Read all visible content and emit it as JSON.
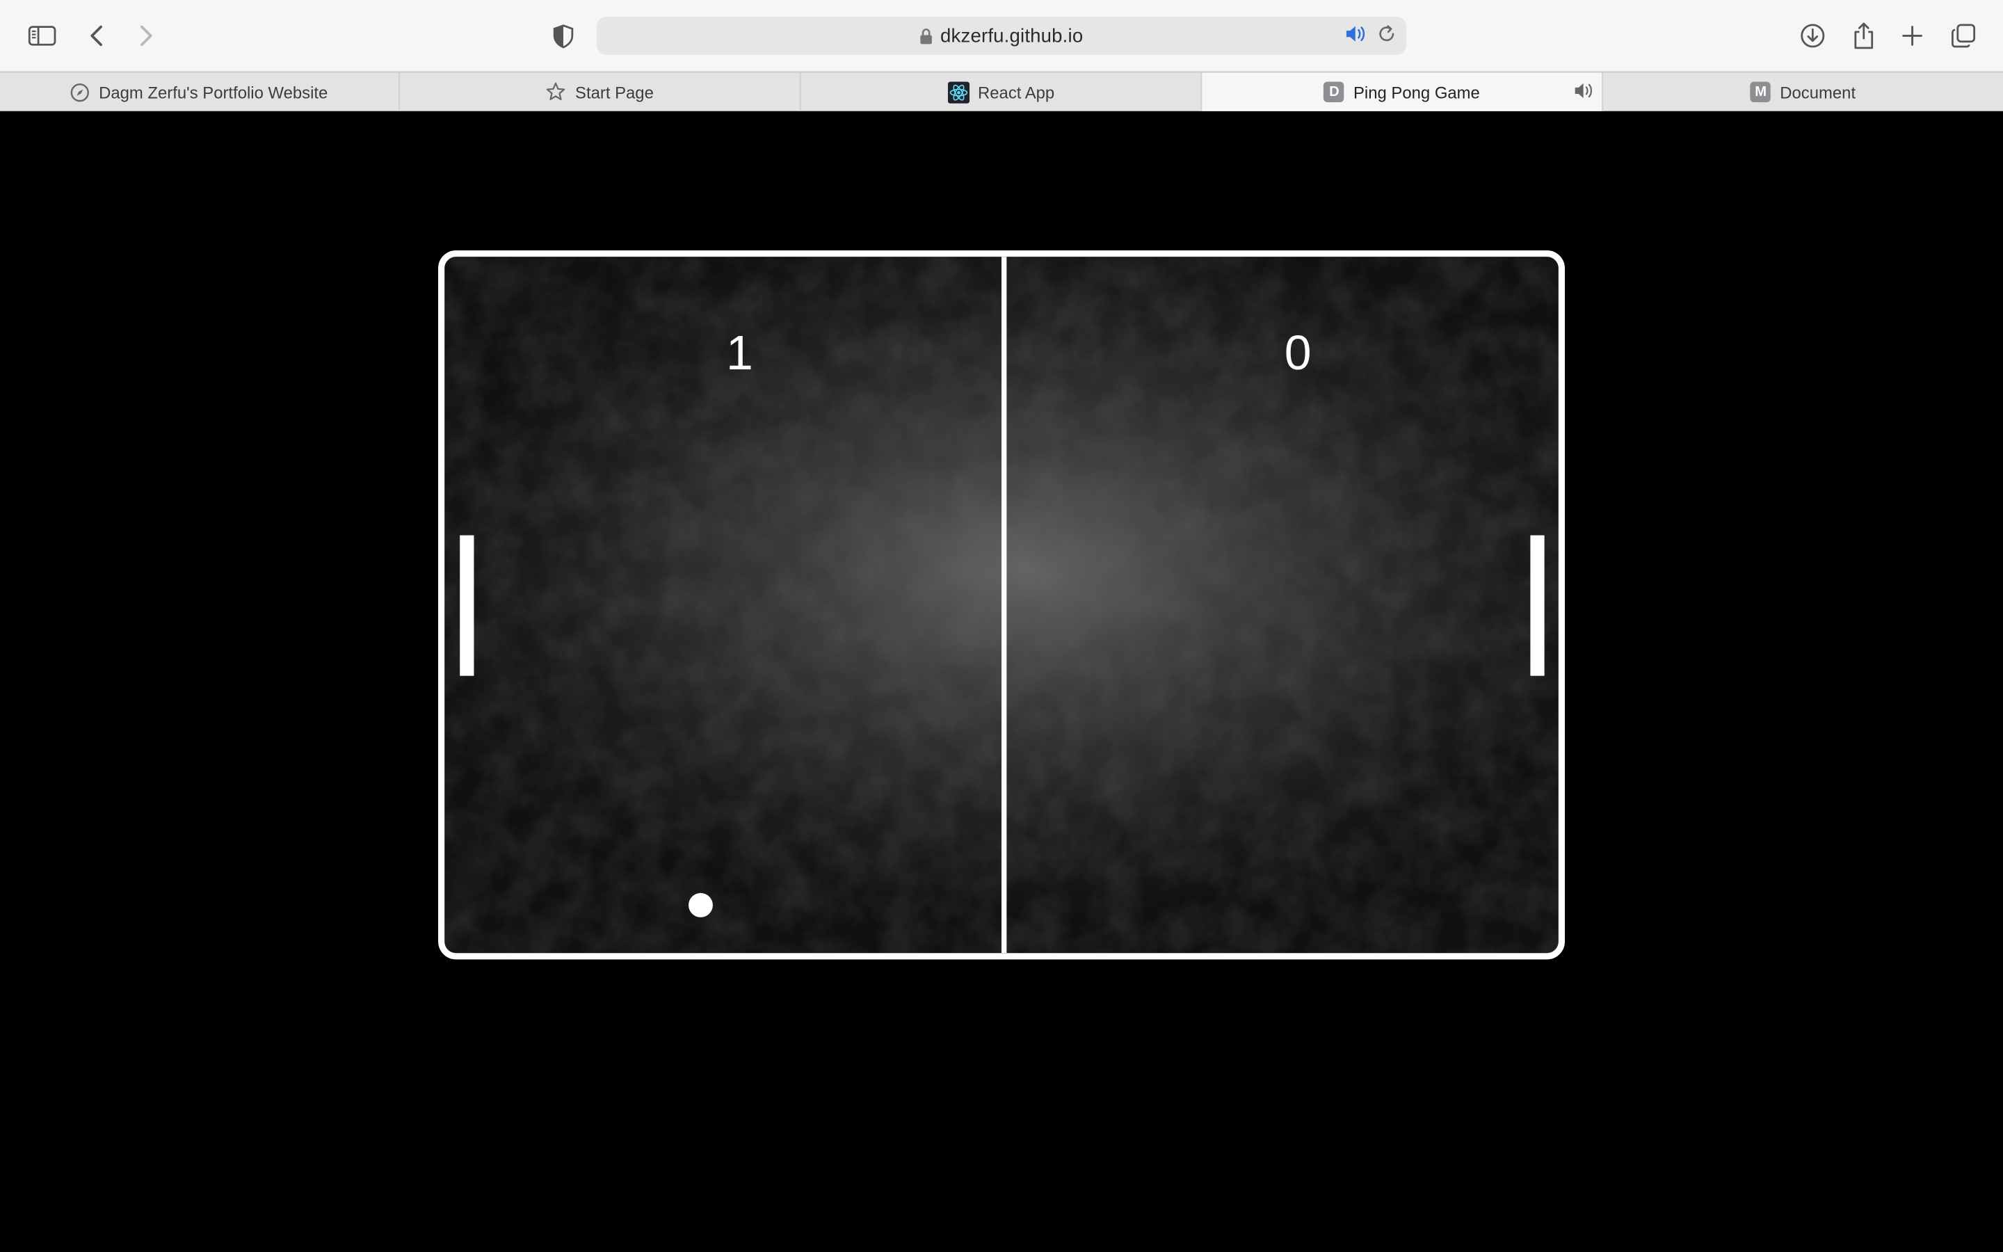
{
  "browser": {
    "url": "dkzerfu.github.io",
    "icons": {
      "sidebar": "sidebar-icon",
      "back": "chevron-left-icon",
      "forward": "chevron-right-icon",
      "privacy": "shield-icon",
      "lock": "lock-icon",
      "audio": "speaker-icon",
      "reload": "reload-icon",
      "downloads": "download-icon",
      "share": "share-icon",
      "new_tab": "plus-icon",
      "tab_overview": "tab-overview-icon"
    },
    "accent_color": "#2f6fde"
  },
  "tabs": [
    {
      "label": "Dagm Zerfu's Portfolio Website",
      "favicon": "compass-icon",
      "active": false
    },
    {
      "label": "Start Page",
      "favicon": "star-icon",
      "active": false
    },
    {
      "label": "React App",
      "favicon": "react-icon",
      "active": false
    },
    {
      "label": "Ping Pong Game",
      "favicon_letter": "D",
      "active": true,
      "playing_audio": true
    },
    {
      "label": "Document",
      "favicon_letter": "M",
      "active": false
    }
  ],
  "game": {
    "score_left": "1",
    "score_right": "0",
    "board_color": "#ffffff",
    "background": "#000000"
  }
}
